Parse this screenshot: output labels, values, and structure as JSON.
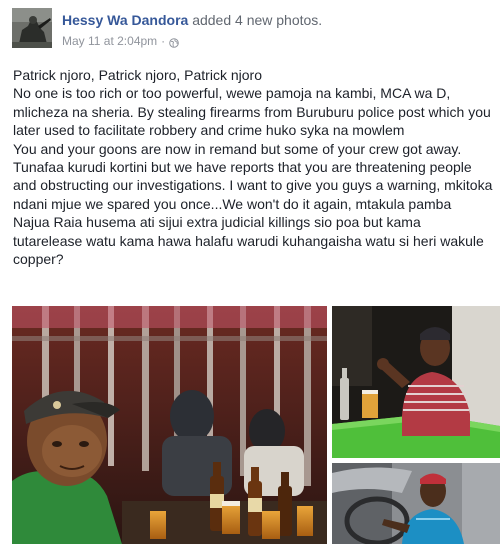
{
  "post": {
    "author": "Hessy Wa Dandora",
    "action": "added 4 new photos.",
    "timestamp": "May 11 at 2:04pm",
    "separator": "·",
    "privacy_icon": "globe-icon",
    "paragraphs": [
      "Patrick njoro, Patrick njoro, Patrick njoro",
      "No one is too rich or too powerful, wewe pamoja na kambi, MCA wa D, mlicheza na sheria. By stealing firearms from Buruburu police post which you later used to facilitate robbery and crime huko syka na mowlem",
      "You and your goons are now in remand but some of your crew got away.",
      "Tunafaa kurudi kortini but we have reports that you are threatening people and obstructing our investigations. I want to give you guys a warning, mkitoka ndani mjue we spared you once...We won't do it again, mtakula pamba",
      "Najua Raia husema ati sijui extra judicial killings sio poa but kama tutarelease watu kama hawa halafu warudi kuhangaisha watu si heri wakule copper?"
    ]
  },
  "colors": {
    "author_link": "#365899",
    "meta_text": "#90949c",
    "body_text": "#1d2129"
  }
}
